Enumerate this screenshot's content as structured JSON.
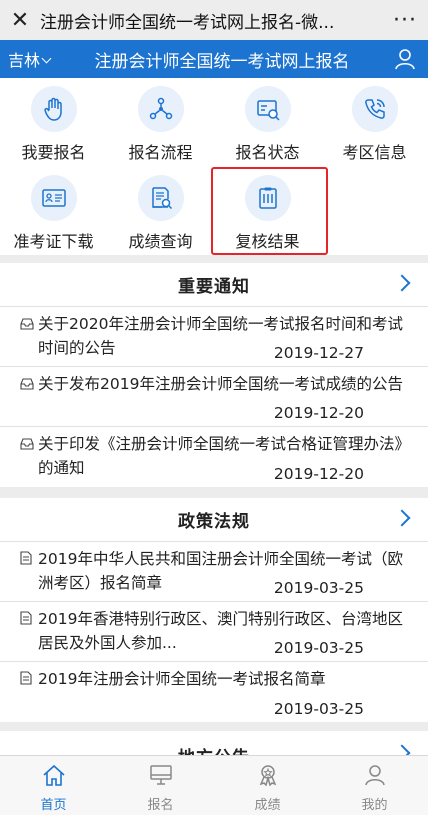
{
  "topbar": {
    "close_icon": "close-icon",
    "title": "注册会计师全国统一考试网上报名-微...",
    "more_icon": "more-icon"
  },
  "header": {
    "region": "吉林",
    "title": "注册会计师全国统一考试网上报名",
    "user_icon": "user-icon"
  },
  "menu": [
    {
      "label": "我要报名",
      "icon": "hand-icon"
    },
    {
      "label": "报名流程",
      "icon": "flow-icon"
    },
    {
      "label": "报名状态",
      "icon": "id-card-icon"
    },
    {
      "label": "考区信息",
      "icon": "phone-icon"
    },
    {
      "label": "准考证下载",
      "icon": "admission-card-icon"
    },
    {
      "label": "成绩查询",
      "icon": "score-search-icon"
    },
    {
      "label": "复核结果",
      "icon": "clipboard-icon"
    }
  ],
  "notices": {
    "title": "重要通知",
    "items": [
      {
        "text": "关于2020年注册会计师全国统一考试报名时间和考试时间的公告",
        "date": "2019-12-27"
      },
      {
        "text": "关于发布2019年注册会计师全国统一考试成绩的公告",
        "date": "2019-12-20"
      },
      {
        "text": "关于印发《注册会计师全国统一考试合格证管理办法》的通知",
        "date": "2019-12-20"
      }
    ]
  },
  "policies": {
    "title": "政策法规",
    "items": [
      {
        "text": "2019年中华人民共和国注册会计师全国统一考试（欧洲考区）报名简章",
        "date": "2019-03-25"
      },
      {
        "text": "2019年香港特别行政区、澳门特别行政区、台湾地区居民及外国人参加...",
        "date": "2019-03-25"
      },
      {
        "text": "2019年注册会计师全国统一考试报名简章",
        "date": "2019-03-25"
      }
    ]
  },
  "partial_section": {
    "title": "地方公告"
  },
  "tabs": [
    {
      "label": "首页",
      "icon": "home-icon",
      "active": true
    },
    {
      "label": "报名",
      "icon": "monitor-icon",
      "active": false
    },
    {
      "label": "成绩",
      "icon": "badge-icon",
      "active": false
    },
    {
      "label": "我的",
      "icon": "person-icon",
      "active": false
    }
  ],
  "colors": {
    "brand": "#1c74d0",
    "highlight": "#e4262b",
    "tab_active": "#1c74d0",
    "tab_inactive": "#888888"
  }
}
